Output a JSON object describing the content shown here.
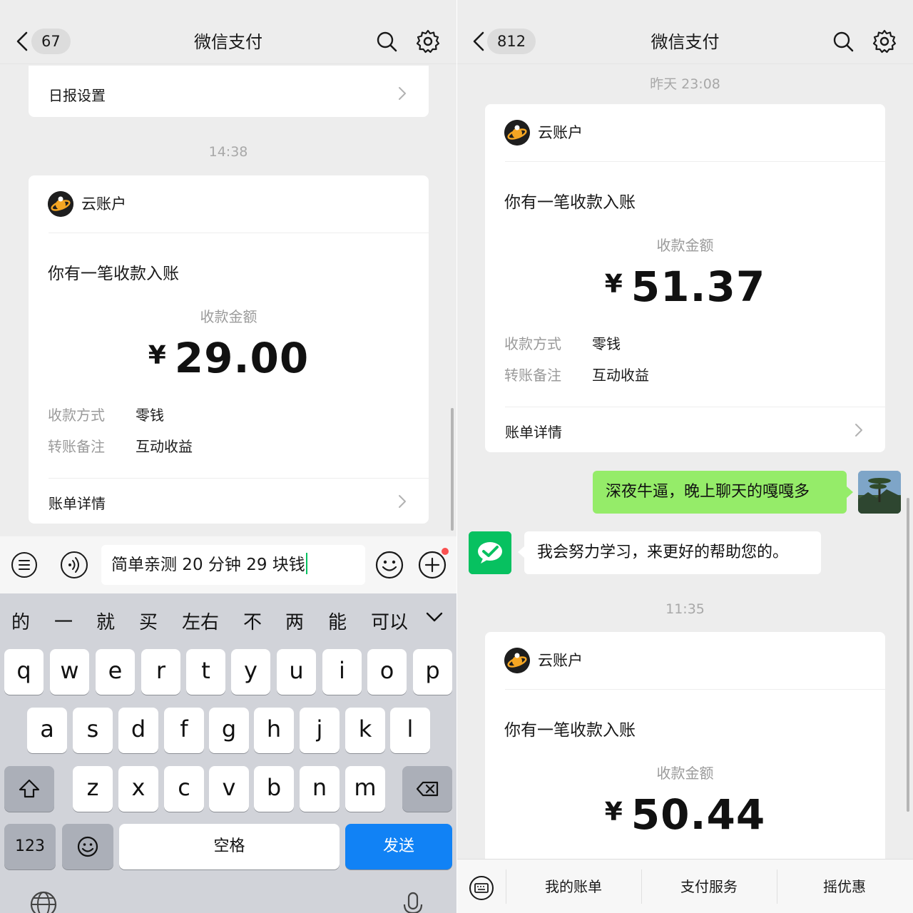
{
  "left": {
    "nav": {
      "badge": "67",
      "title": "微信支付"
    },
    "top_card": {
      "label": "日报设置"
    },
    "time": "14:38",
    "pay_card": {
      "account": "云账户",
      "notice": "你有一笔收款入账",
      "amount_label": "收款金额",
      "currency": "¥",
      "amount": "29.00",
      "method_key": "收款方式",
      "method_val": "零钱",
      "note_key": "转账备注",
      "note_val": "互动收益",
      "detail": "账单详情"
    },
    "input": {
      "text": "简单亲测 20 分钟 29 块钱"
    },
    "candidates": [
      "的",
      "一",
      "就",
      "买",
      "左右",
      "不",
      "两",
      "能",
      "可以"
    ],
    "keyboard": {
      "row1": [
        "q",
        "w",
        "e",
        "r",
        "t",
        "y",
        "u",
        "i",
        "o",
        "p"
      ],
      "row2": [
        "a",
        "s",
        "d",
        "f",
        "g",
        "h",
        "j",
        "k",
        "l"
      ],
      "row3": [
        "z",
        "x",
        "c",
        "v",
        "b",
        "n",
        "m"
      ],
      "num_key": "123",
      "space_key": "空格",
      "send_key": "发送"
    }
  },
  "right": {
    "nav": {
      "badge": "812",
      "title": "微信支付"
    },
    "time1": "昨天 23:08",
    "card1": {
      "account": "云账户",
      "notice": "你有一笔收款入账",
      "amount_label": "收款金额",
      "currency": "¥",
      "amount": "51.37",
      "method_key": "收款方式",
      "method_val": "零钱",
      "note_key": "转账备注",
      "note_val": "互动收益",
      "detail": "账单详情"
    },
    "msg_me": "深夜牛逼，晚上聊天的嘎嘎多",
    "msg_them": "我会努力学习，来更好的帮助您的。",
    "time2": "11:35",
    "card2": {
      "account": "云账户",
      "notice": "你有一笔收款入账",
      "amount_label": "收款金额",
      "currency": "¥",
      "amount": "50.44"
    },
    "bottom_menu": [
      "我的账单",
      "支付服务",
      "摇优惠"
    ]
  },
  "colors": {
    "bg": "#ededed",
    "card": "#ffffff",
    "my_bubble": "#95ec69",
    "send_button": "#1182f5",
    "wechat_pay_green": "#07c160"
  },
  "icons": [
    "back-icon",
    "search-icon",
    "gear-icon",
    "chevron-right-icon",
    "voice-icon",
    "list-icon",
    "emoji-icon",
    "add-icon",
    "shift-icon",
    "backspace-icon",
    "globe-icon",
    "mic-icon",
    "keyboard-icon",
    "wechat-pay-icon"
  ]
}
